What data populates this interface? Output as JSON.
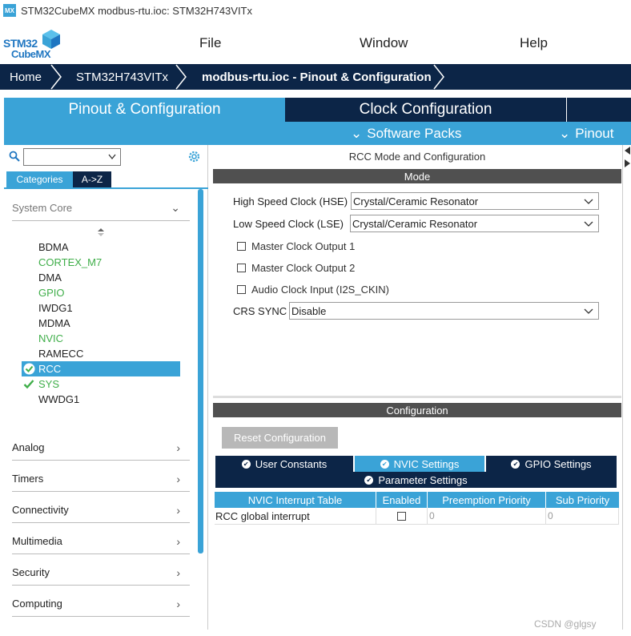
{
  "window": {
    "badge": "MX",
    "title": "STM32CubeMX modbus-rtu.ioc: STM32H743VITx"
  },
  "logo": {
    "line1": "STM32",
    "line2": "CubeMX"
  },
  "menu": {
    "file": "File",
    "window": "Window",
    "help": "Help"
  },
  "breadcrumb": {
    "home": "Home",
    "mcu": "STM32H743VITx",
    "project": "modbus-rtu.ioc - Pinout & Configuration"
  },
  "tabs": {
    "pinout_config": "Pinout & Configuration",
    "clock_config": "Clock Configuration"
  },
  "subtabs": {
    "software_packs": "Software Packs",
    "pinout": "Pinout"
  },
  "left": {
    "search_value": "",
    "categories_tab": "Categories",
    "az_tab": "A->Z",
    "system_core": "System Core",
    "peripherals": [
      {
        "name": "BDMA",
        "status": "normal"
      },
      {
        "name": "CORTEX_M7",
        "status": "green"
      },
      {
        "name": "DMA",
        "status": "normal"
      },
      {
        "name": "GPIO",
        "status": "green"
      },
      {
        "name": "IWDG1",
        "status": "normal"
      },
      {
        "name": "MDMA",
        "status": "normal"
      },
      {
        "name": "NVIC",
        "status": "green"
      },
      {
        "name": "RAMECC",
        "status": "normal"
      },
      {
        "name": "RCC",
        "status": "selected"
      },
      {
        "name": "SYS",
        "status": "checked"
      },
      {
        "name": "WWDG1",
        "status": "normal"
      }
    ],
    "sections": [
      "Analog",
      "Timers",
      "Connectivity",
      "Multimedia",
      "Security",
      "Computing"
    ]
  },
  "right": {
    "title": "RCC Mode and Configuration",
    "mode_header": "Mode",
    "hse_label": "High Speed Clock (HSE)",
    "hse_value": "Crystal/Ceramic Resonator",
    "lse_label": "Low Speed Clock (LSE)",
    "lse_value": "Crystal/Ceramic Resonator",
    "mco1": "Master Clock Output 1",
    "mco2": "Master Clock Output 2",
    "i2s_ckin": "Audio Clock Input (I2S_CKIN)",
    "crs_label": "CRS SYNC",
    "crs_value": "Disable",
    "config_header": "Configuration",
    "reset_button": "Reset Configuration",
    "cfg_tabs": {
      "user_constants": "User Constants",
      "nvic_settings": "NVIC Settings",
      "gpio_settings": "GPIO Settings",
      "parameter_settings": "Parameter Settings"
    },
    "nvic_table": {
      "headers": [
        "NVIC Interrupt Table",
        "Enabled",
        "Preemption Priority",
        "Sub Priority"
      ],
      "rows": [
        {
          "name": "RCC global interrupt",
          "enabled": false,
          "preemption": "0",
          "sub": "0"
        }
      ]
    }
  },
  "watermark": "CSDN @glgsy",
  "colors": {
    "navy": "#0c2547",
    "accent": "#3aa3d7",
    "green": "#3fae49",
    "header_gray": "#505050"
  }
}
